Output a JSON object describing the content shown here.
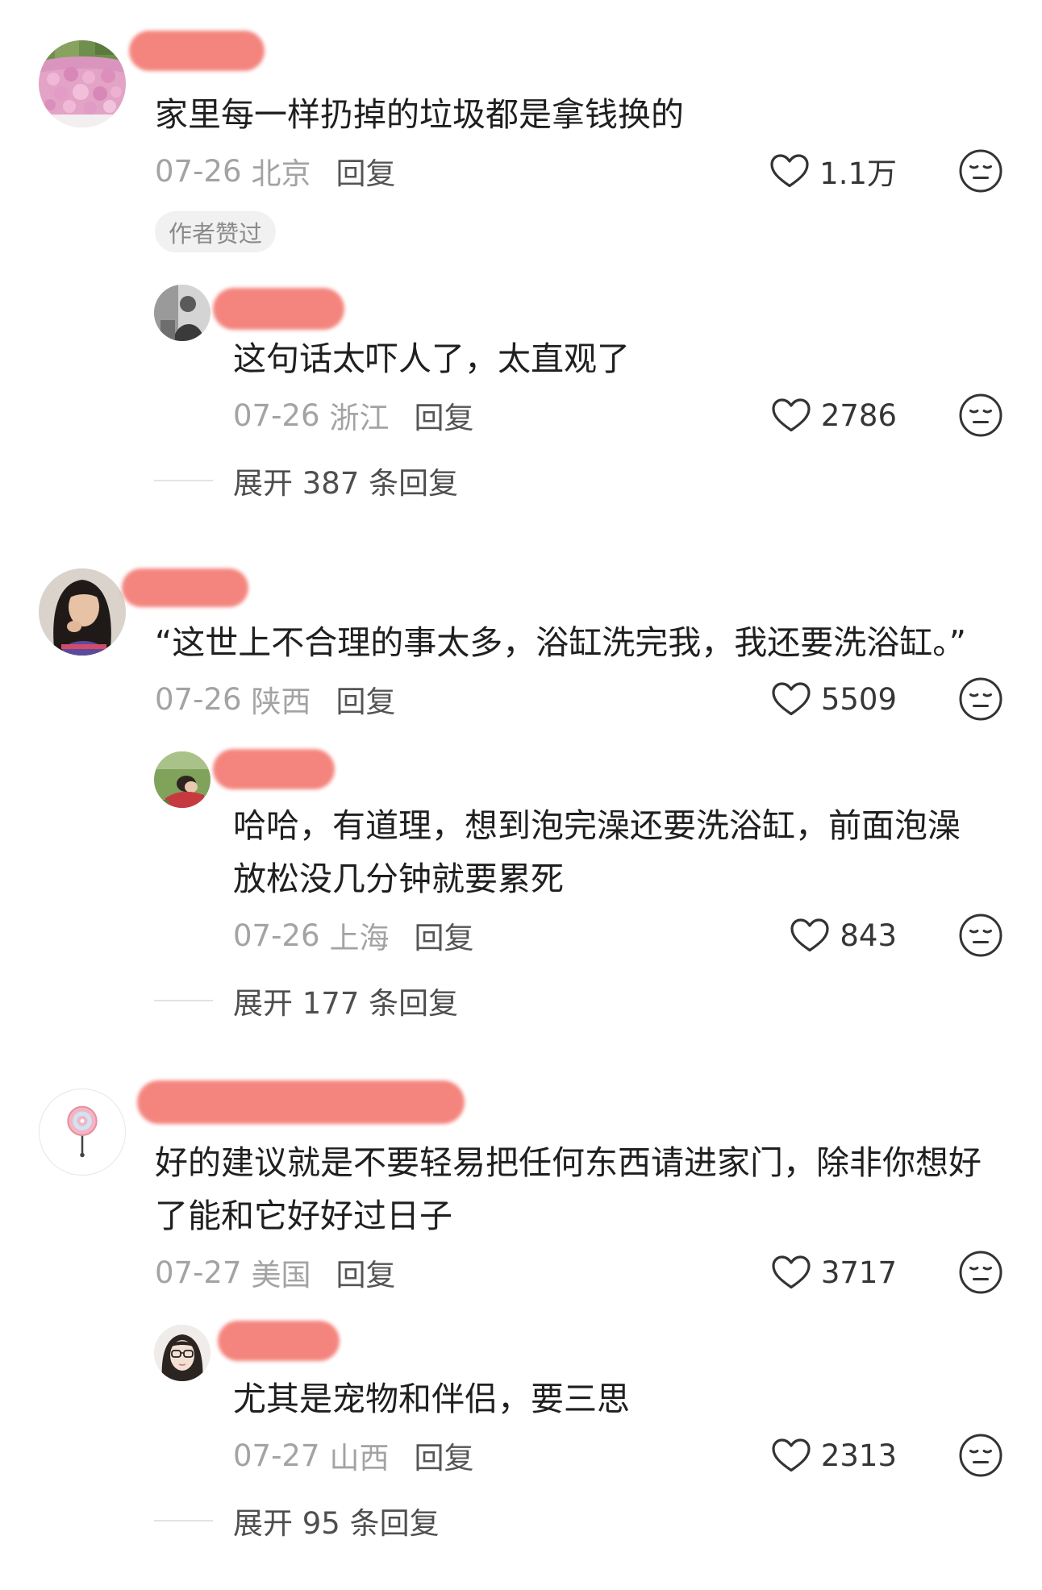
{
  "colors": {
    "redaction": "#f4857e",
    "text_primary": "#1f1f1f",
    "text_meta": "#a3a3a3",
    "badge_bg": "#f1f1f1"
  },
  "icons": {
    "like": "heart-icon",
    "reaction": "meh-face-icon",
    "avatar_comment_3": "lollipop-icon"
  },
  "comments": [
    {
      "text": "家里每一样扔掉的垃圾都是拿钱换的",
      "date": "07-26",
      "location": "北京",
      "reply_label": "回复",
      "likes": "1.1万",
      "badge": "作者赞过",
      "replies": [
        {
          "text": "这句话太吓人了，太直观了",
          "date": "07-26",
          "location": "浙江",
          "reply_label": "回复",
          "likes": "2786"
        }
      ],
      "expand_label": "展开 387 条回复"
    },
    {
      "text": "“这世上不合理的事太多，浴缸洗完我，我还要洗浴缸。”",
      "date": "07-26",
      "location": "陕西",
      "reply_label": "回复",
      "likes": "5509",
      "replies": [
        {
          "text": "哈哈，有道理，想到泡完澡还要洗浴缸，前面泡澡放松没几分钟就要累死",
          "date": "07-26",
          "location": "上海",
          "reply_label": "回复",
          "likes": "843"
        }
      ],
      "expand_label": "展开 177 条回复"
    },
    {
      "text": "好的建议就是不要轻易把任何东西请进家门，除非你想好了能和它好好过日子",
      "date": "07-27",
      "location": "美国",
      "reply_label": "回复",
      "likes": "3717",
      "replies": [
        {
          "text": "尤其是宠物和伴侣，要三思",
          "date": "07-27",
          "location": "山西",
          "reply_label": "回复",
          "likes": "2313"
        }
      ],
      "expand_label": "展开 95 条回复"
    }
  ]
}
